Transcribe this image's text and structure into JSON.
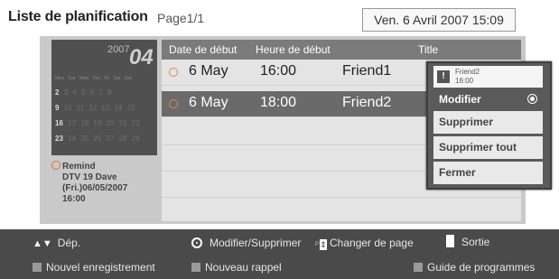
{
  "header": {
    "title": "Liste de planification",
    "page": "Page1/1",
    "datetime": "Ven. 6 Avril 2007 15:09"
  },
  "calendar": {
    "year": "2007",
    "month": "04",
    "weekday_header": "Mon Tue Wed Thu Fri Sat Sun",
    "weeks": [
      {
        "day": "2",
        "rest": "3 4 5 6 7 8"
      },
      {
        "day": "9",
        "rest": "10 11 12 13 14 15"
      },
      {
        "day": "16",
        "rest": "17 18 19 20 21 22"
      },
      {
        "day": "23",
        "rest": "24 25 26 27 28 29"
      }
    ]
  },
  "reminder": {
    "label": "Remind",
    "line1": "DTV 19 Dave",
    "line2": "(Fri.)06/05/2007",
    "line3": "16:00"
  },
  "list": {
    "columns": {
      "start_date": "Date de début",
      "start_time": "Heure de début",
      "title": "Title"
    },
    "rows": [
      {
        "date": "6 May",
        "time": "16:00",
        "title": "Friend1",
        "selected": false
      },
      {
        "date": "6 May",
        "time": "18:00",
        "title": "Friend2",
        "selected": true
      }
    ]
  },
  "popup": {
    "program": "Friend2",
    "time": "16:00",
    "items": [
      "Modifier",
      "Supprimer",
      "Supprimer tout",
      "Fermer"
    ]
  },
  "footer": {
    "move": "Dép.",
    "modify_delete": "Modifier/Supprimer",
    "change_page": "Changer de page",
    "exit": "Sortie",
    "new_recording": "Nouvel enregistrement",
    "new_reminder": "Nouveau rappel",
    "program_guide": "Guide de programmes",
    "page_key": "P"
  },
  "colors": {
    "list_header": "#7b7b7b",
    "selected_row": "#6a6a6a",
    "footer_bg": "#4a4a4a",
    "clock_icon": "#e0874a"
  }
}
